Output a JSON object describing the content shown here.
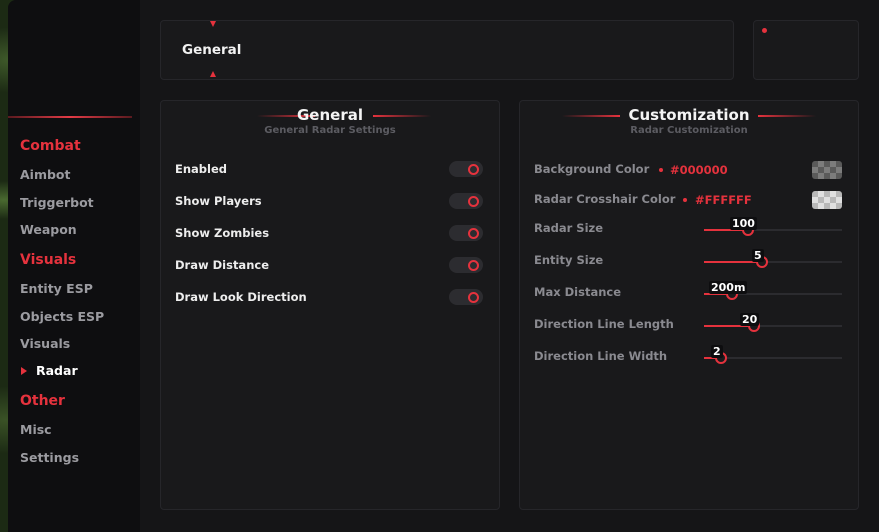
{
  "sidebar": {
    "sections": [
      {
        "label": "Combat",
        "items": [
          "Aimbot",
          "Triggerbot",
          "Weapon"
        ]
      },
      {
        "label": "Visuals",
        "items": [
          "Entity ESP",
          "Objects ESP",
          "Visuals",
          "Radar"
        ]
      },
      {
        "label": "Other",
        "items": [
          "Misc",
          "Settings"
        ]
      }
    ],
    "active_item": "Radar"
  },
  "tabbar": {
    "current_tab": "General"
  },
  "general_card": {
    "title": "General",
    "subtitle": "General Radar Settings",
    "toggles": [
      {
        "label": "Enabled"
      },
      {
        "label": "Show Players"
      },
      {
        "label": "Show Zombies"
      },
      {
        "label": "Draw Distance"
      },
      {
        "label": "Draw Look Direction"
      }
    ]
  },
  "custom_card": {
    "title": "Customization",
    "subtitle": "Radar Customization",
    "colors": [
      {
        "label": "Background Color",
        "hex": "#000000",
        "swatch": "#000000"
      },
      {
        "label": "Radar Crosshair Color",
        "hex": "#FFFFFF",
        "swatch": "#FFFFFF"
      }
    ],
    "sliders": [
      {
        "label": "Radar Size",
        "value": "100",
        "fraction": 0.32
      },
      {
        "label": "Entity Size",
        "value": "5",
        "fraction": 0.42
      },
      {
        "label": "Max Distance",
        "value": "200m",
        "fraction": 0.2
      },
      {
        "label": "Direction Line Length",
        "value": "20",
        "fraction": 0.36
      },
      {
        "label": "Direction Line Width",
        "value": "2",
        "fraction": 0.12
      }
    ]
  },
  "colors": {
    "accent": "#e5323d"
  }
}
